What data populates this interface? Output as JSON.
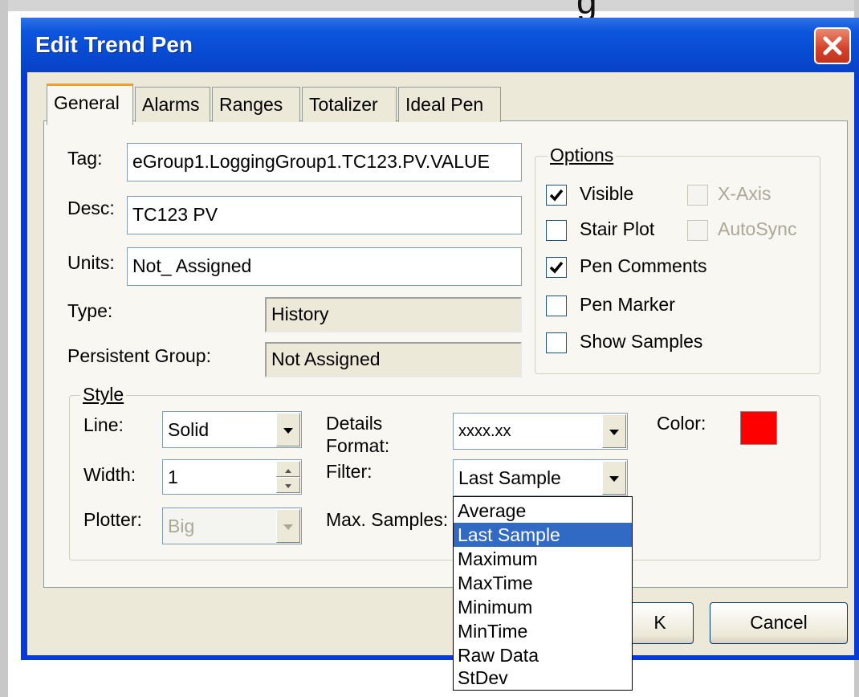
{
  "background": {
    "glyph": "g"
  },
  "window": {
    "title": "Edit Trend Pen",
    "close_icon": "close-icon",
    "accent": "#0a3ad6"
  },
  "tabs": [
    {
      "label": "General",
      "active": true
    },
    {
      "label": "Alarms"
    },
    {
      "label": "Ranges"
    },
    {
      "label": "Totalizer"
    },
    {
      "label": "Ideal Pen"
    }
  ],
  "general": {
    "tag_label": "Tag:",
    "tag_value": "eGroup1.LoggingGroup1.TC123.PV.VALUE",
    "desc_label": "Desc:",
    "desc_value": "TC123 PV",
    "units_label": "Units:",
    "units_value": "Not_ Assigned",
    "type_label": "Type:",
    "type_value": "History",
    "persistent_label": "Persistent Group:",
    "persistent_value": "Not  Assigned"
  },
  "options": {
    "title": "Options",
    "checkboxes": [
      {
        "label": "Visible",
        "checked": true
      },
      {
        "label": "X-Axis",
        "checked": false,
        "disabled": true
      },
      {
        "label": "Stair Plot",
        "checked": false
      },
      {
        "label": "AutoSync",
        "checked": false,
        "disabled": true
      },
      {
        "label": "Pen Comments",
        "checked": true
      },
      {
        "label": "Pen Marker",
        "checked": false
      },
      {
        "label": "Show Samples",
        "checked": false
      }
    ]
  },
  "style": {
    "title": "Style",
    "line_label": "Line:",
    "line_value": "Solid",
    "width_label": "Width:",
    "width_value": "1",
    "plotter_label": "Plotter:",
    "plotter_value": "Big",
    "details_label_1": "Details",
    "details_label_2": "Format:",
    "details_value": "xxxx.xx",
    "filter_label": "Filter:",
    "filter_value": "Last Sample",
    "max_samples_label": "Max. Samples:",
    "color_label": "Color:",
    "color_value": "#ff0000"
  },
  "filter_dropdown": {
    "options": [
      "Average",
      "Last Sample",
      "Maximum",
      "MaxTime",
      "Minimum",
      "MinTime",
      "Raw Data",
      "StDev"
    ],
    "selected": "Last Sample"
  },
  "buttons": {
    "ok_partial": "K",
    "cancel": "Cancel"
  }
}
